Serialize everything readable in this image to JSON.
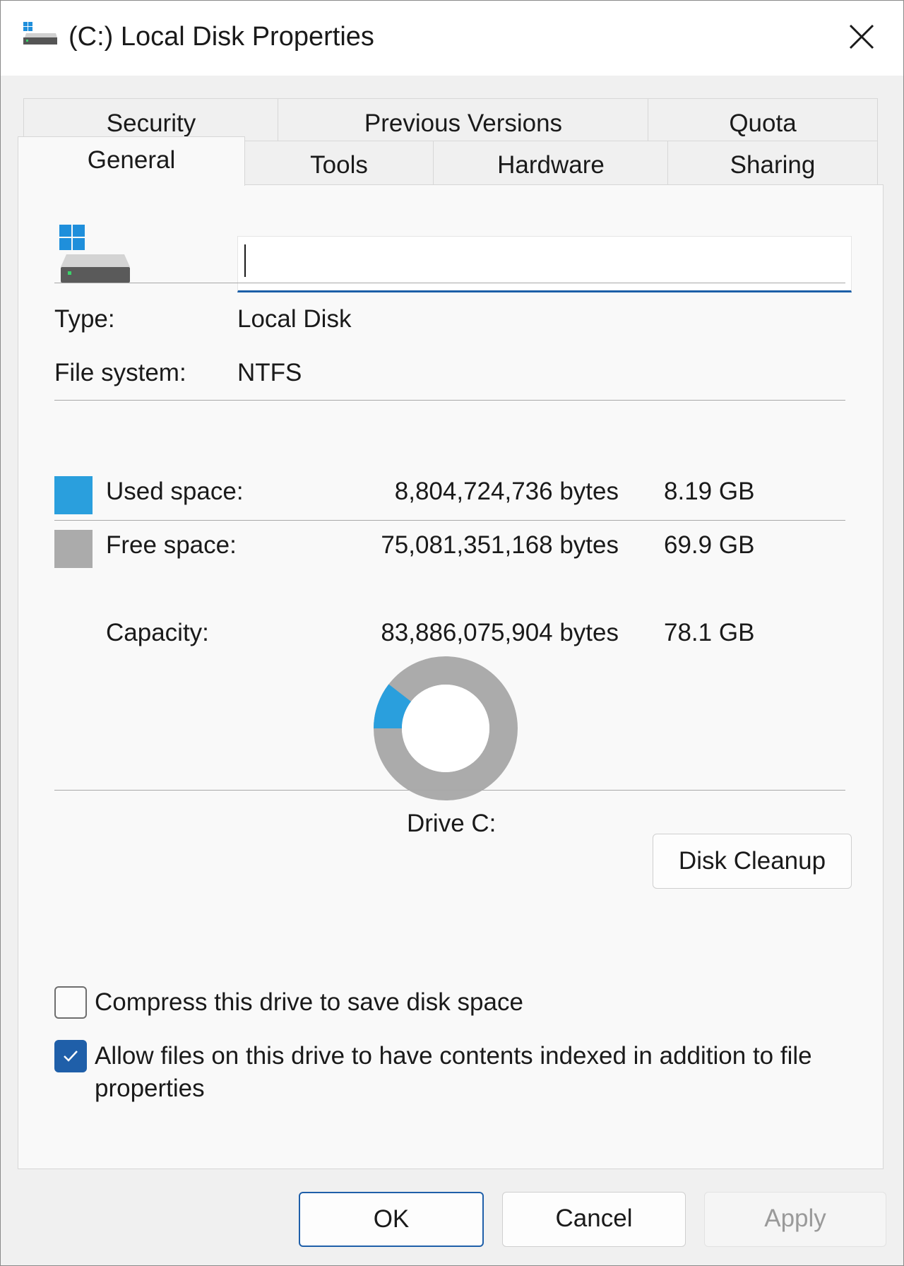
{
  "window": {
    "title": "(C:) Local Disk Properties"
  },
  "tabs": {
    "row1": [
      {
        "label": "Security"
      },
      {
        "label": "Previous Versions"
      },
      {
        "label": "Quota"
      }
    ],
    "row2": [
      {
        "label": "General",
        "active": true
      },
      {
        "label": "Tools"
      },
      {
        "label": "Hardware"
      },
      {
        "label": "Sharing"
      }
    ]
  },
  "general": {
    "name_value": "",
    "type_label": "Type:",
    "type_value": "Local Disk",
    "fs_label": "File system:",
    "fs_value": "NTFS",
    "used": {
      "label": "Used space:",
      "bytes": "8,804,724,736 bytes",
      "size": "8.19 GB",
      "color": "#2a9fdd"
    },
    "free": {
      "label": "Free space:",
      "bytes": "75,081,351,168 bytes",
      "size": "69.9 GB",
      "color": "#ababab"
    },
    "capacity": {
      "label": "Capacity:",
      "bytes": "83,886,075,904 bytes",
      "size": "78.1 GB"
    },
    "drive_label": "Drive C:",
    "cleanup_label": "Disk Cleanup",
    "compress_label": "Compress this drive to save disk space",
    "compress_checked": false,
    "index_label": "Allow files on this drive to have contents indexed in addition to file properties",
    "index_checked": true
  },
  "usage": {
    "used_fraction": 0.105
  },
  "icons": {
    "title": "drive-icon",
    "close": "close-icon",
    "drive": "windows-drive-icon",
    "check": "checkmark-icon"
  },
  "buttons": {
    "ok": "OK",
    "cancel": "Cancel",
    "apply": "Apply"
  }
}
